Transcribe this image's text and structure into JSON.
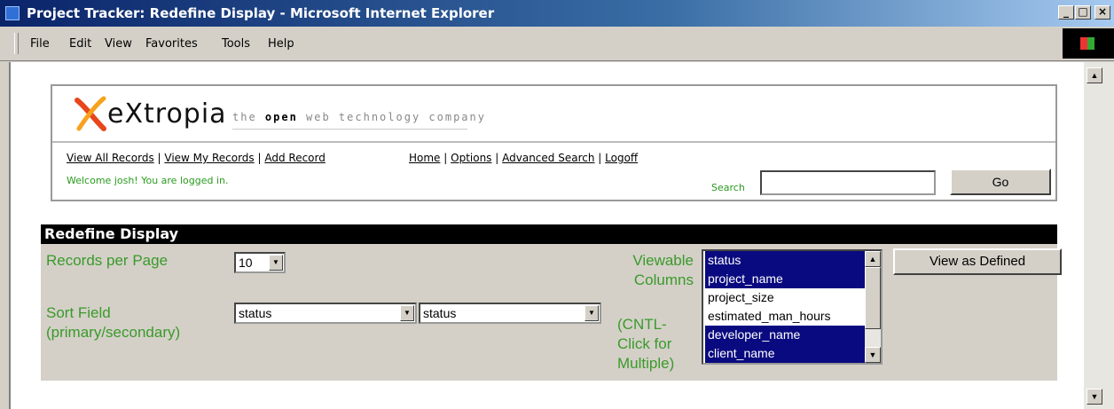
{
  "window": {
    "title": "Project Tracker: Redefine Display - Microsoft Internet Explorer",
    "minimize_glyph": "_",
    "maximize_glyph": "□",
    "close_glyph": "×"
  },
  "menu": {
    "items": [
      {
        "label": "File"
      },
      {
        "label": "Edit"
      },
      {
        "label": "View"
      },
      {
        "label": "Favorites"
      },
      {
        "label": "Tools"
      },
      {
        "label": "Help"
      }
    ]
  },
  "header": {
    "logo_word": "eXtropia",
    "tagline_pre": "the ",
    "tagline_bold": "open",
    "tagline_post": " web technology company",
    "nav_left": [
      "View All Records",
      "View My Records",
      "Add Record"
    ],
    "nav_right": [
      "Home",
      "Options",
      "Advanced Search",
      "Logoff"
    ],
    "welcome": "Welcome josh! You are logged in.",
    "search_label": "Search",
    "search_value": "",
    "go_label": "Go"
  },
  "panel": {
    "title": "Redefine Display",
    "records_per_page_label": "Records per Page",
    "records_per_page_value": "10",
    "sort_field_label_1": "Sort Field",
    "sort_field_label_2": "(primary/secondary)",
    "sort_primary": "status",
    "sort_secondary": "status",
    "viewable_label_1": "Viewable",
    "viewable_label_2": "Columns",
    "hint_1": "(CNTL-",
    "hint_2": "Click for",
    "hint_3": "Multiple)",
    "columns": [
      {
        "label": "status",
        "selected": true
      },
      {
        "label": "project_name",
        "selected": true
      },
      {
        "label": "project_size",
        "selected": false
      },
      {
        "label": "estimated_man_hours",
        "selected": false
      },
      {
        "label": "developer_name",
        "selected": true
      },
      {
        "label": "client_name",
        "selected": true
      }
    ],
    "view_button_label": "View as Defined"
  },
  "colors": {
    "label_green": "#3a9a2a",
    "selection_navy": "#0a0a80",
    "logo_red": "#e8461b",
    "logo_orange": "#f7a21b"
  }
}
